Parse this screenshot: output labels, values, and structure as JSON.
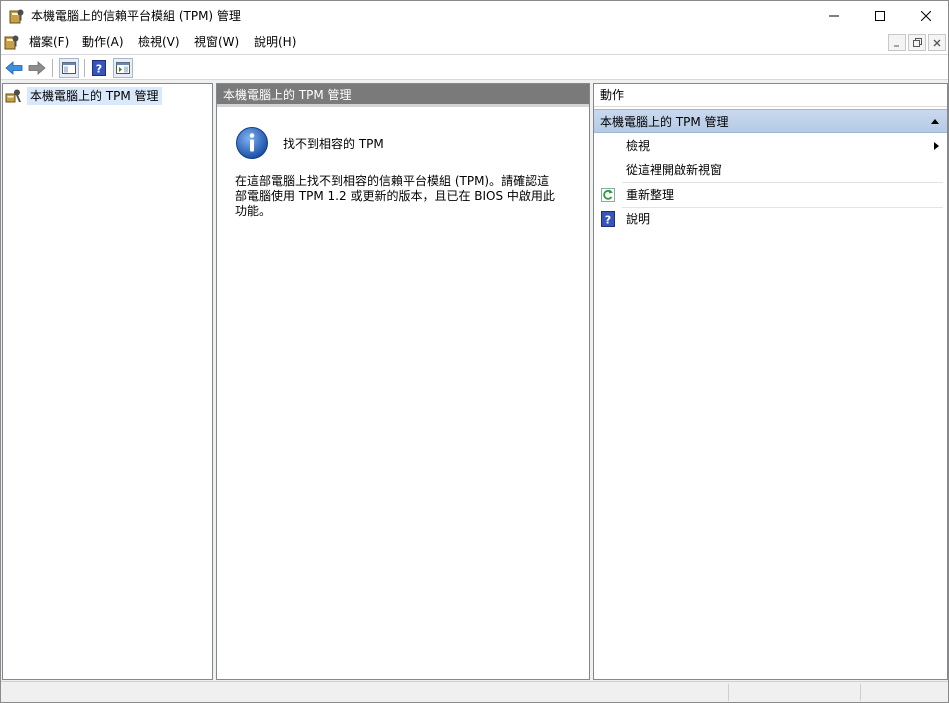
{
  "window": {
    "title": "本機電腦上的信賴平台模組 (TPM) 管理"
  },
  "menu": {
    "items": [
      {
        "label": "檔案(F)"
      },
      {
        "label": "動作(A)"
      },
      {
        "label": "檢視(V)"
      },
      {
        "label": "視窗(W)"
      },
      {
        "label": "說明(H)"
      }
    ]
  },
  "tree": {
    "items": [
      {
        "label": "本機電腦上的 TPM 管理"
      }
    ]
  },
  "center": {
    "header": "本機電腦上的 TPM 管理",
    "message_title": "找不到相容的 TPM",
    "message_body": "在這部電腦上找不到相容的信賴平台模組 (TPM)。請確認這部電腦使用 TPM 1.2 或更新的版本，且已在 BIOS 中啟用此功能。"
  },
  "actions": {
    "header": "動作",
    "section_title": "本機電腦上的 TPM 管理",
    "items": [
      {
        "label": "檢視",
        "icon": "none",
        "submenu": true
      },
      {
        "label": "從這裡開啟新視窗",
        "icon": "none",
        "submenu": false
      },
      {
        "label": "重新整理",
        "icon": "refresh-icon",
        "submenu": false
      },
      {
        "label": "說明",
        "icon": "help-icon",
        "submenu": false
      }
    ]
  },
  "colors": {
    "accent": "#b5cae6",
    "header_gray": "#7a7a7a",
    "selection": "#d9e8fb"
  }
}
